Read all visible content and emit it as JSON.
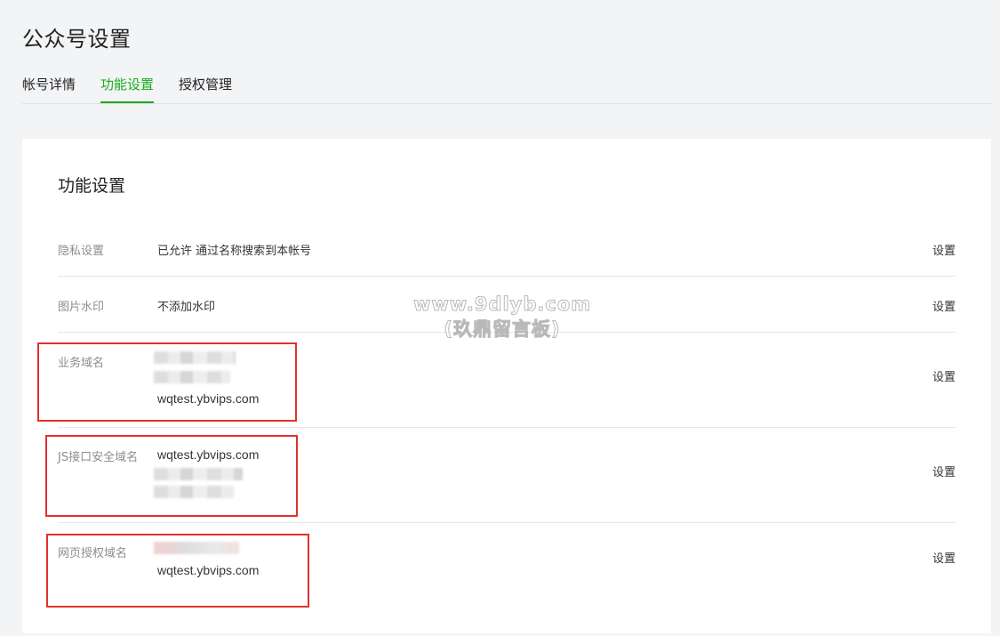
{
  "header": {
    "title": "公众号设置"
  },
  "tabs": [
    {
      "label": "帐号详情"
    },
    {
      "label": "功能设置"
    },
    {
      "label": "授权管理"
    }
  ],
  "active_tab": "功能设置",
  "section": {
    "title": "功能设置"
  },
  "rows": [
    {
      "label": "隐私设置",
      "value": "已允许 通过名称搜索到本帐号",
      "action": "设置"
    },
    {
      "label": "图片水印",
      "value": "不添加水印",
      "action": "设置"
    },
    {
      "label": "业务域名",
      "domain": "wqtest.ybvips.com",
      "action": "设置"
    },
    {
      "label": "JS接口安全域名",
      "domain": "wqtest.ybvips.com",
      "action": "设置"
    },
    {
      "label": "网页授权域名",
      "domain": "wqtest.ybvips.com",
      "action": "设置"
    }
  ],
  "watermark": {
    "line1": "www.9dlyb.com",
    "line2": "(玖鼎留言板)"
  },
  "colors": {
    "accent": "#1aad19",
    "highlight_box": "#e0312f",
    "background": "#f3f4f6"
  }
}
